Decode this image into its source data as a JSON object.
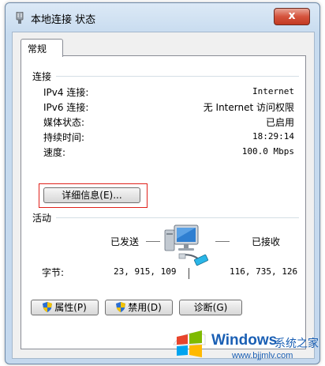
{
  "window": {
    "title": "本地连接 状态",
    "close_label": "x"
  },
  "tab": {
    "label": "常规"
  },
  "connection": {
    "section_label": "连接",
    "rows": [
      {
        "label": "IPv4 连接:",
        "value": "Internet"
      },
      {
        "label": "IPv6 连接:",
        "value": "无 Internet 访问权限"
      },
      {
        "label": "媒体状态:",
        "value": "已启用"
      },
      {
        "label": "持续时间:",
        "value": "18:29:14"
      },
      {
        "label": "速度:",
        "value": "100.0 Mbps"
      }
    ],
    "details_button": "详细信息(E)..."
  },
  "activity": {
    "section_label": "活动",
    "sent_label": "已发送",
    "received_label": "已接收",
    "bytes_label": "字节:",
    "bytes_sent": "23, 915, 109",
    "bytes_received": "116, 735, 126"
  },
  "buttons": {
    "properties": "属性(P)",
    "disable": "禁用(D)",
    "diagnose": "诊断(G)"
  },
  "watermark": {
    "brand": "Windows",
    "suffix": "系统之家",
    "url": "www.bjjmlv.com"
  },
  "colors": {
    "highlight_border": "#e0211b",
    "close_button": "#c9452e",
    "windows_blue": "#1a5fb4"
  }
}
